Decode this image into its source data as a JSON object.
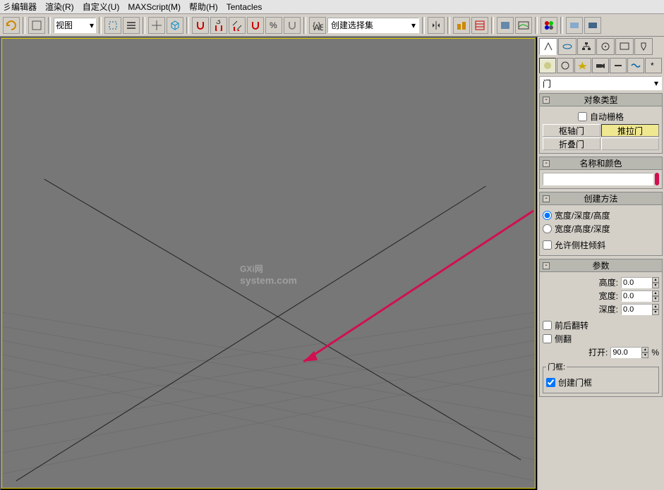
{
  "menu": {
    "items": [
      "彡编辑器",
      "渲染(R)",
      "自定义(U)",
      "MAXScript(M)",
      "帮助(H)",
      "Tentacles"
    ]
  },
  "toolbar": {
    "rotate_mode": "视图",
    "selection_set_label": "创建选择集"
  },
  "command_panel": {
    "category_dropdown": "门",
    "rollouts": {
      "object_type": {
        "title": "对象类型",
        "auto_grid": "自动栅格",
        "buttons": [
          "枢轴门",
          "推拉门",
          "折叠门",
          ""
        ]
      },
      "name_color": {
        "title": "名称和颜色",
        "name_value": "",
        "color": "#8888cc"
      },
      "creation": {
        "title": "创建方法",
        "opt1": "宽度/深度/高度",
        "opt2": "宽度/高度/深度",
        "allow_slant": "允许侧柱倾斜"
      },
      "params": {
        "title": "参数",
        "height_label": "高度:",
        "height_val": "0.0",
        "width_label": "宽度:",
        "width_val": "0.0",
        "depth_label": "深度:",
        "depth_val": "0.0",
        "flip_fb": "前后翻转",
        "flip_side": "侧翻",
        "open_label": "打开:",
        "open_val": "90.0",
        "open_unit": "%",
        "frame_group": "门框:",
        "create_frame": "创建门框"
      }
    }
  },
  "watermark": {
    "main": "GXi网",
    "sub": "system.com"
  }
}
